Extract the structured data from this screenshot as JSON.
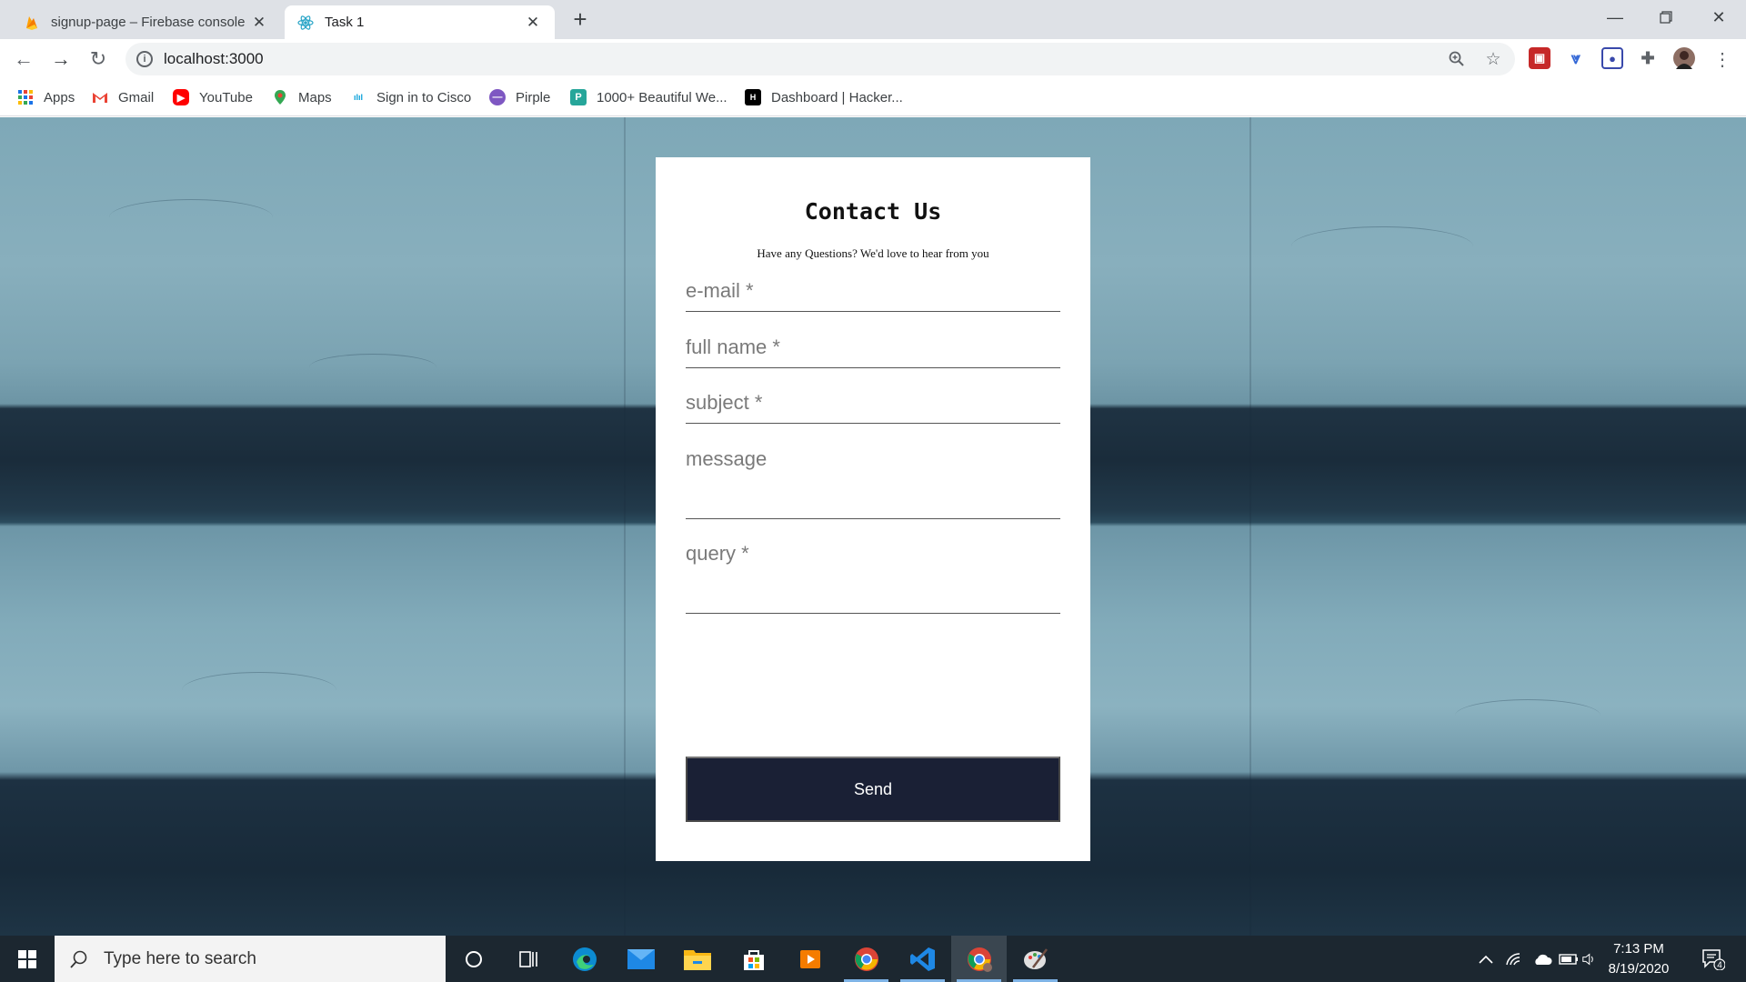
{
  "browser": {
    "tabs": [
      {
        "title": "signup-page – Firebase console",
        "favicon": "firebase-icon"
      },
      {
        "title": "Task 1",
        "favicon": "react-icon"
      }
    ],
    "address": "localhost:3000",
    "bookmarks": [
      {
        "label": "Apps",
        "icon": "apps-grid-icon"
      },
      {
        "label": "Gmail",
        "icon": "gmail-icon"
      },
      {
        "label": "YouTube",
        "icon": "youtube-icon"
      },
      {
        "label": "Maps",
        "icon": "maps-icon"
      },
      {
        "label": "Sign in to Cisco",
        "icon": "cisco-icon"
      },
      {
        "label": "Pirple",
        "icon": "pirple-icon"
      },
      {
        "label": "1000+ Beautiful We...",
        "icon": "bookmark-p-icon"
      },
      {
        "label": "Dashboard | Hacker...",
        "icon": "hackerrank-icon"
      }
    ]
  },
  "contact": {
    "title": "Contact Us",
    "subtitle": "Have any Questions? We'd love to hear from you",
    "fields": {
      "email": "e-mail *",
      "full_name": "full name *",
      "subject": "subject *",
      "message": "message",
      "query": "query *"
    },
    "send_label": "Send"
  },
  "taskbar": {
    "search_placeholder": "Type here to search",
    "time": "7:13 PM",
    "date": "8/19/2020",
    "notification_count": "4"
  },
  "colors": {
    "card_bg": "#ffffff",
    "send_button": "#1a2035",
    "wall_light": "#82abba",
    "wall_dark": "#1a2c3b"
  }
}
